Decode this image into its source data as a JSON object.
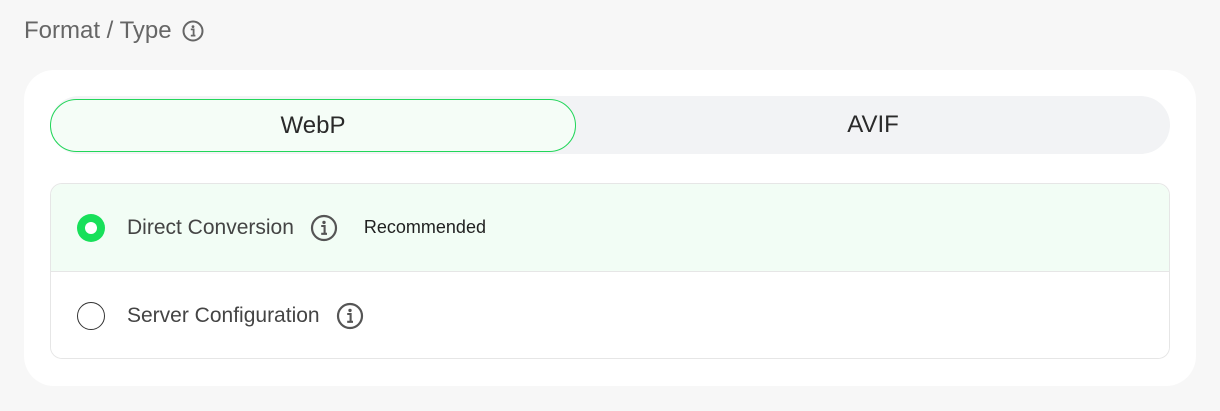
{
  "section": {
    "title": "Format / Type",
    "info_icon": "info-icon"
  },
  "format_toggle": {
    "options": [
      {
        "label": "WebP",
        "selected": true
      },
      {
        "label": "AVIF",
        "selected": false
      }
    ]
  },
  "conversion": {
    "options": [
      {
        "label": "Direct Conversion",
        "selected": true,
        "badge": "Recommended",
        "icon": "info-icon"
      },
      {
        "label": "Server Configuration",
        "selected": false,
        "icon": "info-icon"
      }
    ]
  },
  "colors": {
    "accent": "#18e05a",
    "selected_row_bg": "#f2fdf5",
    "toggle_bg": "#f2f3f5"
  }
}
